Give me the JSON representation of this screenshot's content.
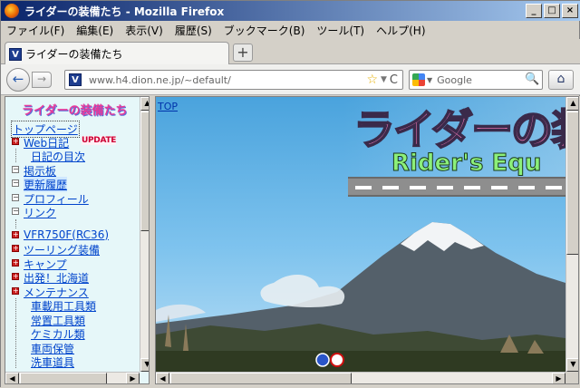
{
  "window": {
    "title": "ライダーの装備たち - Mozilla Firefox",
    "buttons": [
      "_",
      "□",
      "×"
    ]
  },
  "menu": [
    "ファイル(F)",
    "編集(E)",
    "表示(V)",
    "履歴(S)",
    "ブックマーク(B)",
    "ツール(T)",
    "ヘルプ(H)"
  ],
  "tab": {
    "title": "ライダーの装備たち",
    "favicon": "V",
    "new_tab": "+"
  },
  "nav": {
    "url": "www.h4.dion.ne.jp/~default/",
    "search_placeholder": "Google",
    "back_icon": "←",
    "forward_icon": "→",
    "star_icon": "☆",
    "reload_icon": "C",
    "home_icon": "⌂"
  },
  "sidebar": {
    "logo": "ライダーの装備たち",
    "items": [
      {
        "label": "トップページ",
        "kind": "top"
      },
      {
        "label": "Web日記",
        "kind": "plus",
        "badge": "UPDATE"
      },
      {
        "label": "日記の目次",
        "kind": "child"
      },
      {
        "label": "掲示板",
        "kind": "minus"
      },
      {
        "label": "更新履歴",
        "kind": "minus",
        "selected": true
      },
      {
        "label": "プロフィール",
        "kind": "minus"
      },
      {
        "label": "リンク",
        "kind": "minus"
      },
      {
        "label": "",
        "kind": "gap"
      },
      {
        "label": "VFR750F(RC36)",
        "kind": "plus"
      },
      {
        "label": "ツーリング装備",
        "kind": "plus"
      },
      {
        "label": "キャンプ",
        "kind": "plus"
      },
      {
        "label": "出発！北海道",
        "kind": "plus"
      },
      {
        "label": "メンテナンス",
        "kind": "plus"
      },
      {
        "label": "車載用工具類",
        "kind": "child"
      },
      {
        "label": "常置工具類",
        "kind": "child"
      },
      {
        "label": "ケミカル類",
        "kind": "child"
      },
      {
        "label": "車両保管",
        "kind": "child"
      },
      {
        "label": "洗車道具",
        "kind": "child"
      }
    ]
  },
  "main": {
    "top_link": "TOP",
    "banner_title": "ライダーの装",
    "banner_subtitle": "Rider's Equ"
  }
}
